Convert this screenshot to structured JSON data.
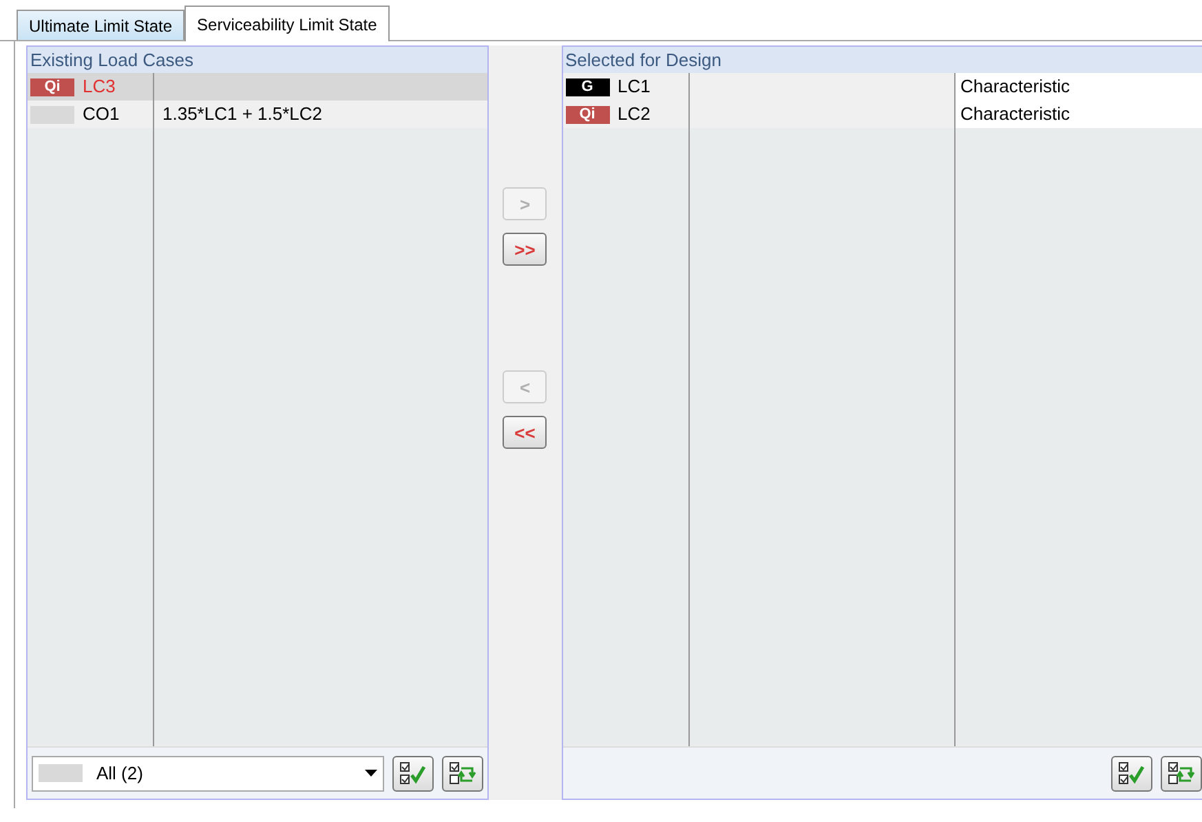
{
  "tabs": [
    {
      "label": "Ultimate Limit State",
      "selected": false
    },
    {
      "label": "Serviceability Limit State",
      "selected": true
    }
  ],
  "existing": {
    "title": "Existing Load Cases",
    "rows": [
      {
        "badge": "Qi",
        "color": "#c0504d",
        "name": "LC3",
        "description": "",
        "selected": true,
        "invalid": true
      },
      {
        "badge": "",
        "color": "#d9d9d9",
        "name": "CO1",
        "description": "1.35*LC1 + 1.5*LC2",
        "selected": false,
        "invalid": false
      }
    ],
    "filter": {
      "value": "All (2)",
      "color": "#d9d9d9"
    }
  },
  "transfer_buttons": [
    {
      "label": ">",
      "disabled": true
    },
    {
      "label": ">>",
      "disabled": false
    },
    {
      "label": "<",
      "disabled": true
    },
    {
      "label": "<<",
      "disabled": false
    }
  ],
  "selected": {
    "title": "Selected for Design",
    "rows": [
      {
        "badge": "G",
        "color": "#000000",
        "name": "LC1",
        "combination": "Characteristic"
      },
      {
        "badge": "Qi",
        "color": "#c0504d",
        "name": "LC2",
        "combination": "Characteristic"
      }
    ]
  }
}
